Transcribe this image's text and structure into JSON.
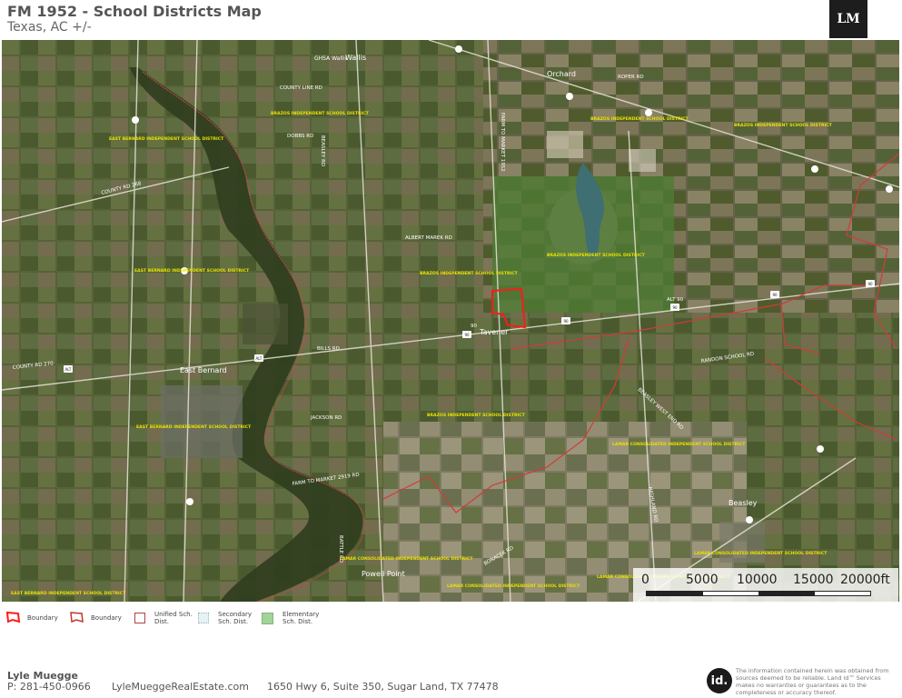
{
  "header": {
    "title": "FM 1952 - School Districts Map",
    "subtitle": "Texas,  AC +/-",
    "logo_text": "LM"
  },
  "map": {
    "roads": [
      {
        "label": "COUNTY LINE RD"
      },
      {
        "label": "FARM TO MARKET 1952"
      },
      {
        "label": "BEASLEY RD"
      },
      {
        "label": "DOBBS RD"
      },
      {
        "label": "ROPER RD"
      },
      {
        "label": "COUNTY RD 268"
      },
      {
        "label": "ALBERT MAREK RD"
      },
      {
        "label": "BILLS RD"
      },
      {
        "label": "JACKSON RD"
      },
      {
        "label": "RANDON SCHOOL RD"
      },
      {
        "label": "FARM TO MARKET 2919 RD"
      },
      {
        "label": "BATTLE RD"
      },
      {
        "label": "BONACEK RD"
      },
      {
        "label": "HIGHLAND RD"
      },
      {
        "label": "BEASLEY WEST END RD"
      },
      {
        "label": "COUNTY RD 270"
      },
      {
        "label": "ALT 90"
      },
      {
        "label": "90"
      }
    ],
    "school_district_labels": [
      {
        "label": "BRAZOS INDEPENDENT SCHOOL DISTRICT"
      },
      {
        "label": "EAST BERNARD INDEPENDENT SCHOOL DISTRICT"
      },
      {
        "label": "LAMAR CONSOLIDATED INDEPENDENT SCHOOL DISTRICT"
      }
    ],
    "towns": [
      {
        "label": "Wallis"
      },
      {
        "label": "Orchard"
      },
      {
        "label": "East Bernard"
      },
      {
        "label": "Tavener"
      },
      {
        "label": "Beasley"
      },
      {
        "label": "Powell Point"
      },
      {
        "label": "GHSA Wallis"
      }
    ],
    "colors": {
      "district_boundary": "#d23a3a",
      "subject_property": "#ff1a1a",
      "school_label": "#e8e000"
    }
  },
  "scale": {
    "ticks": [
      "0",
      "5000",
      "10000",
      "15000",
      "20000ft"
    ]
  },
  "legend": {
    "items": [
      {
        "label": "Boundary",
        "icon": "subject-boundary-icon"
      },
      {
        "label": "Boundary",
        "icon": "district-boundary-icon"
      },
      {
        "label": "Unified Sch. Dist.",
        "icon": "unified-district-swatch"
      },
      {
        "label": "Secondary Sch. Dist.",
        "icon": "secondary-district-swatch"
      },
      {
        "label": "Elementary Sch. Dist.",
        "icon": "elementary-district-swatch"
      }
    ]
  },
  "footer": {
    "agent_name": "Lyle Muegge",
    "phone": "P: 281-450-0966",
    "website": "LyleMueggeRealEstate.com",
    "address": "1650 Hwy 6, Suite 350, Sugar Land, TX 77478",
    "id_logo_text": "id.",
    "disclaimer": "The information contained herein was obtained from sources deemed to be reliable. Land id™ Services makes no warranties or guarantees as to the completeness or accuracy thereof."
  }
}
